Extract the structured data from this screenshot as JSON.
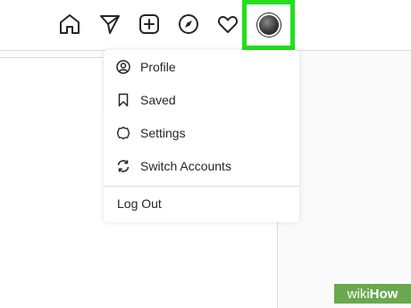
{
  "nav": {
    "icons": [
      "home-icon",
      "direct-icon",
      "new-post-icon",
      "explore-icon",
      "activity-icon",
      "profile-avatar"
    ]
  },
  "menu": {
    "items": [
      {
        "label": "Profile",
        "icon": "profile-icon"
      },
      {
        "label": "Saved",
        "icon": "bookmark-icon"
      },
      {
        "label": "Settings",
        "icon": "settings-icon"
      },
      {
        "label": "Switch Accounts",
        "icon": "switch-icon"
      }
    ],
    "logout_label": "Log Out"
  },
  "highlight_color": "#23e01c",
  "watermark": {
    "part1": "wiki",
    "part2": "How"
  }
}
